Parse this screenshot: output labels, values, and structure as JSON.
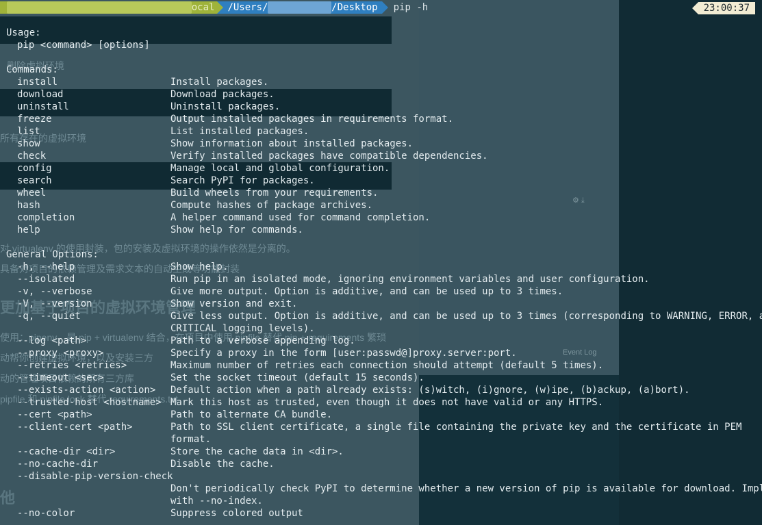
{
  "prompt": {
    "user_segment": "ocal",
    "path_prefix": "/Users/",
    "path_suffix": "/Desktop",
    "command": "pip -h",
    "time": "23:00:37"
  },
  "usage": {
    "heading": "Usage:",
    "line": "pip <command> [options]"
  },
  "commands": {
    "heading": "Commands:",
    "items": [
      {
        "name": "install",
        "desc": "Install packages."
      },
      {
        "name": "download",
        "desc": "Download packages."
      },
      {
        "name": "uninstall",
        "desc": "Uninstall packages."
      },
      {
        "name": "freeze",
        "desc": "Output installed packages in requirements format."
      },
      {
        "name": "list",
        "desc": "List installed packages."
      },
      {
        "name": "show",
        "desc": "Show information about installed packages."
      },
      {
        "name": "check",
        "desc": "Verify installed packages have compatible dependencies."
      },
      {
        "name": "config",
        "desc": "Manage local and global configuration."
      },
      {
        "name": "search",
        "desc": "Search PyPI for packages."
      },
      {
        "name": "wheel",
        "desc": "Build wheels from your requirements."
      },
      {
        "name": "hash",
        "desc": "Compute hashes of package archives."
      },
      {
        "name": "completion",
        "desc": "A helper command used for command completion."
      },
      {
        "name": "help",
        "desc": "Show help for commands."
      }
    ]
  },
  "general": {
    "heading": "General Options:",
    "items": [
      {
        "name": "-h, --help",
        "desc": "Show help."
      },
      {
        "name": "--isolated",
        "desc": "Run pip in an isolated mode, ignoring environment variables and user configuration."
      },
      {
        "name": "-v, --verbose",
        "desc": "Give more output. Option is additive, and can be used up to 3 times."
      },
      {
        "name": "-V, --version",
        "desc": "Show version and exit."
      },
      {
        "name": "-q, --quiet",
        "desc": "Give less output. Option is additive, and can be used up to 3 times (corresponding to WARNING, ERROR, and"
      },
      {
        "name": "",
        "desc": "CRITICAL logging levels)."
      },
      {
        "name": "--log <path>",
        "desc": "Path to a verbose appending log."
      },
      {
        "name": "--proxy <proxy>",
        "desc": "Specify a proxy in the form [user:passwd@]proxy.server:port."
      },
      {
        "name": "--retries <retries>",
        "desc": "Maximum number of retries each connection should attempt (default 5 times)."
      },
      {
        "name": "--timeout <sec>",
        "desc": "Set the socket timeout (default 15 seconds)."
      },
      {
        "name": "--exists-action <action>",
        "desc": "Default action when a path already exists: (s)witch, (i)gnore, (w)ipe, (b)ackup, (a)bort)."
      },
      {
        "name": "--trusted-host <hostname>",
        "desc": "Mark this host as trusted, even though it does not have valid or any HTTPS."
      },
      {
        "name": "--cert <path>",
        "desc": "Path to alternate CA bundle."
      },
      {
        "name": "--client-cert <path>",
        "desc": "Path to SSL client certificate, a single file containing the private key and the certificate in PEM"
      },
      {
        "name": "",
        "desc": "format."
      },
      {
        "name": "--cache-dir <dir>",
        "desc": "Store the cache data in <dir>."
      },
      {
        "name": "--no-cache-dir",
        "desc": "Disable the cache."
      },
      {
        "name": "--disable-pip-version-check",
        "desc": ""
      },
      {
        "name": "",
        "desc": "Don't periodically check PyPI to determine whether a new version of pip is available for download. Implied"
      },
      {
        "name": "",
        "desc": "with --no-index."
      },
      {
        "name": "--no-color",
        "desc": "Suppress colored output"
      }
    ]
  },
  "background": {
    "texts": [
      "删除虚拟环境",
      "所有存在的虚拟环境",
      "对 virtualenv 的使用封装，包的安装及虚拟环境的操作依然是分离的。",
      "具备对项目的依赖管理及需求文本的自动生成等功能封装",
      "更加基于项目的虚拟环境管理",
      "使用：pipenv，是 pip + virtualenv 结合，在项目中使用 pipfile 替代 pip + requirements 繁琐",
      "动帮你创建虚拟环境，以及安装三方",
      "动的管理项目依赖的所有三方库",
      "pipfile 和 pipfile.lock 替代 requirements.txt",
      "他"
    ],
    "event_log": "Event Log"
  }
}
